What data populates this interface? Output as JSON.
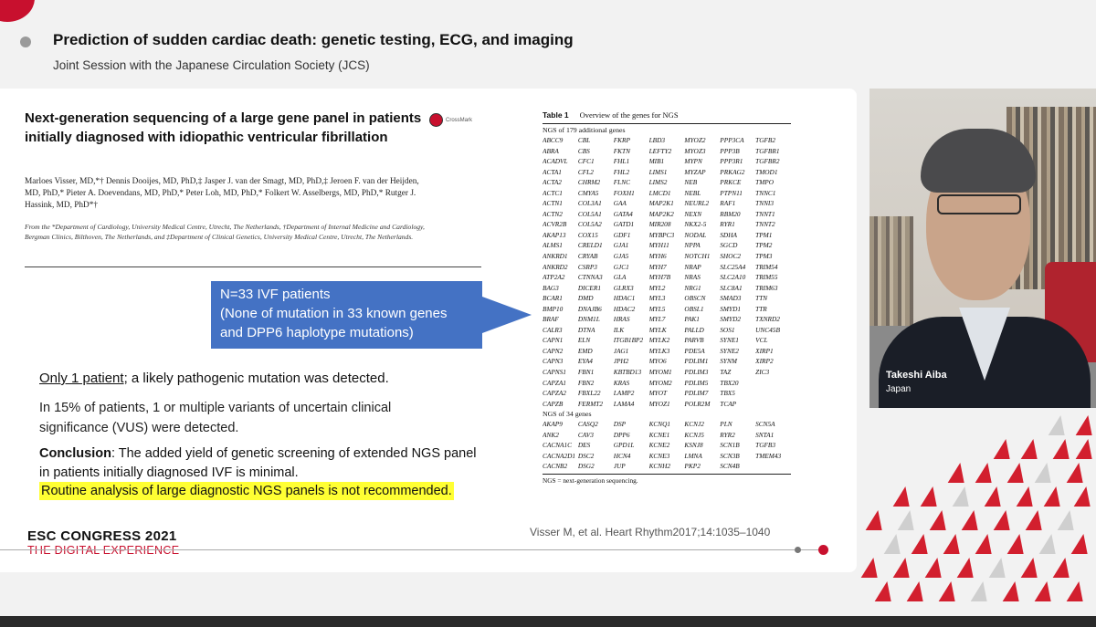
{
  "header": {
    "title": "Prediction of sudden cardiac death: genetic testing, ECG, and imaging",
    "subtitle": "Joint Session with the Japanese Circulation Society (JCS)"
  },
  "paper": {
    "title": "Next-generation sequencing of a large gene panel in patients initially diagnosed with idiopathic ventricular fibrillation",
    "crossmark": "CrossMark",
    "authors": "Marloes Visser, MD,*† Dennis Dooijes, MD, PhD,‡ Jasper J. van der Smagt, MD, PhD,‡ Jeroen F. van der Heijden, MD, PhD,* Pieter A. Doevendans, MD, PhD,* Peter Loh, MD, PhD,* Folkert W. Asselbergs, MD, PhD,* Rutger J. Hassink, MD, PhD*†",
    "affiliations": "From the *Department of Cardiology, University Medical Centre, Utrecht, The Netherlands, †Department of Internal Medicine and Cardiology, Bergman Clinics, Bilthoven, The Netherlands, and ‡Department of Clinical Genetics, University Medical Centre, Utrecht, The Netherlands."
  },
  "callout": {
    "line1": "N=33 IVF patients",
    "line2": "(None of mutation in 33 known genes",
    "line3": "and DPP6 haplotype mutations)"
  },
  "findings": {
    "only_one": "Only 1 patient",
    "only_one_rest": "; a likely pathogenic mutation was detected.",
    "vus": "In 15% of patients, 1 or multiple variants of uncertain clinical significance (VUS) were detected.",
    "conclusion_label": "Conclusion",
    "conclusion_text": ": The added yield of genetic screening of extended NGS panel in patients initially diagnosed IVF is minimal.",
    "recommendation": "Routine analysis of large diagnostic NGS panels is not recommended."
  },
  "table": {
    "number": "Table 1",
    "caption": "Overview of the genes for NGS",
    "section1": "NGS of 179 additional genes",
    "genes1": [
      "ABCC9",
      "CBL",
      "FKRP",
      "LBD3",
      "MYOZ2",
      "PPP3CA",
      "TGFB2",
      "ABRA",
      "CBS",
      "FKTN",
      "LEFTY2",
      "MYOZ3",
      "PPP3B",
      "TGFBR1",
      "ACADVL",
      "CFC1",
      "FHL1",
      "MIB1",
      "MYPN",
      "PPP3R1",
      "TGFBR2",
      "ACTA1",
      "CFL2",
      "FHL2",
      "LIMS1",
      "MYZAP",
      "PRKAG2",
      "TMOD1",
      "ACTA2",
      "CHRM2",
      "FLNC",
      "LIMS2",
      "NEB",
      "PRKCE",
      "TMPO",
      "ACTC1",
      "CMYA5",
      "FOXH1",
      "LMCD1",
      "NEBL",
      "PTPN11",
      "TNNC1",
      "ACTN1",
      "COL3A1",
      "GAA",
      "MAP2K1",
      "NEURL2",
      "RAF1",
      "TNNI3",
      "ACTN2",
      "COL5A1",
      "GATA4",
      "MAP2K2",
      "NEXN",
      "RBM20",
      "TNNT1",
      "ACVR2B",
      "COL5A2",
      "GATD1",
      "MIR208",
      "NKX2-5",
      "RYR1",
      "TNNT2",
      "AKAP13",
      "COX15",
      "GDF1",
      "MYBPC3",
      "NODAL",
      "SDHA",
      "TPM1",
      "ALMS1",
      "CRELD1",
      "GJA1",
      "MYH11",
      "NPPA",
      "SGCD",
      "TPM2",
      "ANKRD1",
      "CRYAB",
      "GJA5",
      "MYH6",
      "NOTCH1",
      "SHOC2",
      "TPM3",
      "ANKRD2",
      "CSRP3",
      "GJC1",
      "MYH7",
      "NRAP",
      "SLC25A4",
      "TRIM54",
      "ATP2A2",
      "CTNNA3",
      "GLA",
      "MYH7B",
      "NRAS",
      "SLC2A10",
      "TRIM55",
      "BAG3",
      "DICER1",
      "GLRX3",
      "MYL2",
      "NRG1",
      "SLC8A1",
      "TRIM63",
      "BCAR1",
      "DMD",
      "HDAC1",
      "MYL3",
      "OBSCN",
      "SMAD3",
      "TTN",
      "BMP10",
      "DNAJB6",
      "HDAC2",
      "MYL5",
      "OBSL1",
      "SMYD1",
      "TTR",
      "BRAF",
      "DNM1L",
      "HRAS",
      "MYL7",
      "PAK1",
      "SMYD2",
      "TXNRD2",
      "CALR3",
      "DTNA",
      "ILK",
      "MYLK",
      "PALLD",
      "SOS1",
      "UNC45B",
      "CAPN1",
      "ELN",
      "ITGB1BP2",
      "MYLK2",
      "PARVB",
      "SYNE1",
      "VCL",
      "CAPN2",
      "EMD",
      "JAG1",
      "MYLK3",
      "PDE5A",
      "SYNE2",
      "XIRP1",
      "CAPN3",
      "EYA4",
      "JPH2",
      "MYO6",
      "PDLIM1",
      "SYNM",
      "XIRP2",
      "CAPNS1",
      "FBN1",
      "KBTBD13",
      "MYOM1",
      "PDLIM3",
      "TAZ",
      "ZIC3",
      "CAPZA1",
      "FBN2",
      "KRAS",
      "MYOM2",
      "PDLIM5",
      "TBX20",
      "",
      "CAPZA2",
      "FBXL22",
      "LAMP2",
      "MYOT",
      "PDLIM7",
      "TBX5",
      "",
      "CAPZB",
      "FERMT2",
      "LAMA4",
      "MYOZ1",
      "POLR2M",
      "TCAP",
      ""
    ],
    "section2": "NGS of 34 genes",
    "genes2": [
      "AKAP9",
      "CASQ2",
      "DSP",
      "KCNQ1",
      "KCNJ2",
      "PLN",
      "SCN5A",
      "ANK2",
      "CAV3",
      "DPP6",
      "KCNE1",
      "KCNJ5",
      "RYR2",
      "SNTA1",
      "CACNA1C",
      "DES",
      "GPD1L",
      "KCNE2",
      "KSNJ8",
      "SCN1B",
      "TGFB3",
      "CACNA2D1",
      "DSC2",
      "HCN4",
      "KCNE3",
      "LMNA",
      "SCN3B",
      "TMEM43",
      "CACNB2",
      "DSG2",
      "JUP",
      "KCNH2",
      "PKP2",
      "SCN4B",
      ""
    ],
    "note": "NGS = next-generation sequencing."
  },
  "citation": "Visser M, et al. Heart Rhythm2017;14:1035–1040",
  "branding": {
    "congress": "ESC CONGRESS 2021",
    "tagline": "THE DIGITAL EXPERIENCE"
  },
  "speaker": {
    "name": "Takeshi Aiba",
    "country": "Japan"
  },
  "colors": {
    "accent_red": "#c8102e",
    "callout_blue": "#4472c4",
    "highlight_yellow": "#ffff33"
  }
}
